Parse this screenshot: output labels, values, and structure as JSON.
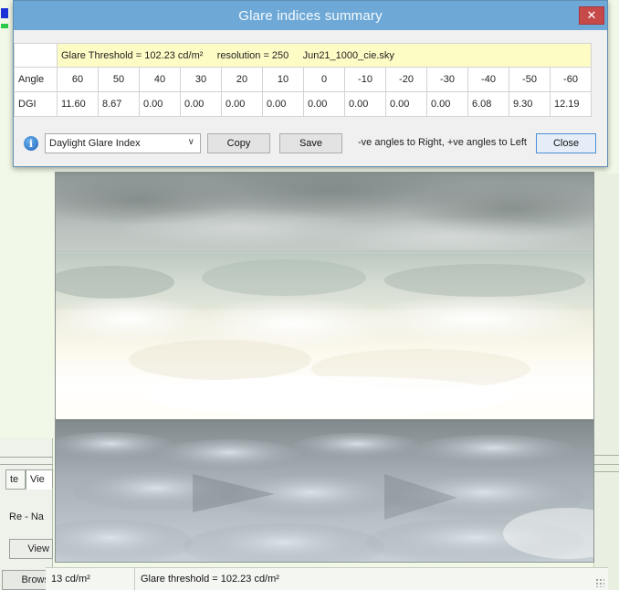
{
  "dialog": {
    "title": "Glare indices summary",
    "close_glyph": "✕",
    "info_row": {
      "threshold": "Glare Threshold = 102.23 cd/m²",
      "resolution": "resolution = 250",
      "sky": "Jun21_1000_cie.sky"
    },
    "table": {
      "angle_label": "Angle",
      "dgi_label": "DGI",
      "angles": [
        "60",
        "50",
        "40",
        "30",
        "20",
        "10",
        "0",
        "-10",
        "-20",
        "-30",
        "-40",
        "-50",
        "-60"
      ],
      "dgi_values": [
        "11.60",
        "8.67",
        "0.00",
        "0.00",
        "0.00",
        "0.00",
        "0.00",
        "0.00",
        "0.00",
        "0.00",
        "6.08",
        "9.30",
        "12.19"
      ]
    },
    "controls": {
      "info_icon": "info-icon",
      "index_select_value": "Daylight Glare Index",
      "copy_label": "Copy",
      "save_label": "Save",
      "hint": "-ve angles to Right, +ve angles to Left",
      "close_label": "Close"
    }
  },
  "background": {
    "tab_partial_1": "te",
    "tab_partial_2": "Vie",
    "label_partial": "Re - Na",
    "view_button": "View",
    "browse_button": "Brows"
  },
  "statusbar": {
    "luminance": "13 cd/m²",
    "glare_threshold": "Glare threshold =  102.23 cd/m²"
  },
  "colors": {
    "titlebar": "#6ea8d6",
    "info_row": "#fefcc5",
    "close_button": "#c64a4a"
  }
}
